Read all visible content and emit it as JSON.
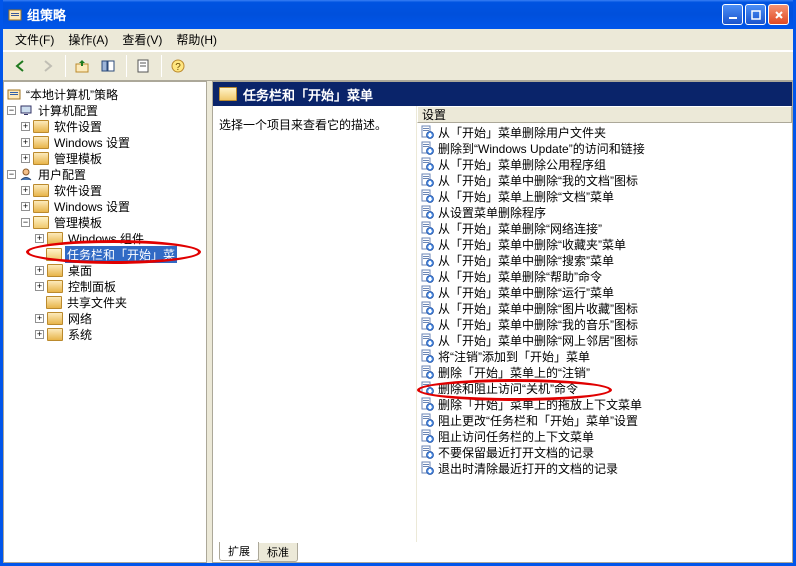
{
  "window": {
    "title": "组策略"
  },
  "menubar": {
    "file": "文件(F)",
    "action": "操作(A)",
    "view": "查看(V)",
    "help": "帮助(H)"
  },
  "tree": {
    "root": {
      "label": "“本地计算机”策略"
    },
    "computer": {
      "label": "计算机配置"
    },
    "comp_soft": {
      "label": "软件设置"
    },
    "comp_win": {
      "label": "Windows 设置"
    },
    "comp_admin": {
      "label": "管理模板"
    },
    "user": {
      "label": "用户配置"
    },
    "user_soft": {
      "label": "软件设置"
    },
    "user_win": {
      "label": "Windows 设置"
    },
    "user_admin": {
      "label": "管理模板"
    },
    "windows_comp": {
      "label": "Windows 组件"
    },
    "taskbar": {
      "label": "任务栏和「开始」菜"
    },
    "desktop": {
      "label": "桌面"
    },
    "control_panel": {
      "label": "控制面板"
    },
    "shared_folders": {
      "label": "共享文件夹"
    },
    "network": {
      "label": "网络"
    },
    "system": {
      "label": "系统"
    }
  },
  "header": {
    "title": "任务栏和「开始」菜单"
  },
  "desc": {
    "prompt": "选择一个项目来查看它的描述。",
    "colHeader": "设置"
  },
  "policies": [
    "从「开始」菜单删除用户文件夹",
    "删除到“Windows Update”的访问和链接",
    "从「开始」菜单删除公用程序组",
    "从「开始」菜单中删除“我的文档”图标",
    "从「开始」菜单上删除“文档”菜单",
    "从设置菜单删除程序",
    "从「开始」菜单删除“网络连接”",
    "从「开始」菜单中删除“收藏夹”菜单",
    "从「开始」菜单中删除“搜索”菜单",
    "从「开始」菜单删除“帮助”命令",
    "从「开始」菜单中删除“运行”菜单",
    "从「开始」菜单中删除“图片收藏”图标",
    "从「开始」菜单中删除“我的音乐”图标",
    "从「开始」菜单中删除“网上邻居”图标",
    "将“注销”添加到「开始」菜单",
    "删除「开始」菜单上的“注销”",
    "删除和阻止访问“关机”命令",
    "删除「开始」菜单上的拖放上下文菜单",
    "阻止更改“任务栏和「开始」菜单”设置",
    "阻止访问任务栏的上下文菜单",
    "不要保留最近打开文档的记录",
    "退出时清除最近打开的文档的记录"
  ],
  "tabs": {
    "extended": "扩展",
    "standard": "标准"
  }
}
